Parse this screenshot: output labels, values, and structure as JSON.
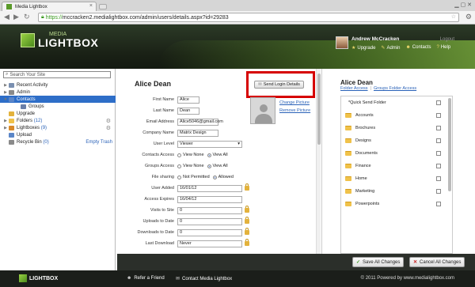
{
  "browser": {
    "tab_title": "Media Lightbox",
    "tab_close": "×",
    "url_scheme": "https://",
    "url_rest": "mccracken2.medialightbox.com/admin/users/details.aspx?id=29283"
  },
  "header": {
    "logo_small": "MEDIA",
    "logo_large": "LIGHTBOX",
    "user_name": "Andrew McCracken",
    "logout": "Logout",
    "menu": [
      {
        "icon": "star-icon",
        "label": "Upgrade"
      },
      {
        "icon": "wrench-icon",
        "label": "Admin"
      },
      {
        "icon": "contacts-icon",
        "label": "Contacts"
      },
      {
        "icon": "help-icon",
        "label": "Help"
      }
    ]
  },
  "sidebar": {
    "search_placeholder": "Search Your Site",
    "items": [
      {
        "label": "Recent Activity",
        "arrow": "▶",
        "color": "#7a8fb0"
      },
      {
        "label": "Admin",
        "arrow": "▶",
        "color": "#8a8a8a"
      },
      {
        "label": "Contacts",
        "arrow": "▼",
        "color": "#5b86c8",
        "selected": true
      },
      {
        "label": "Groups",
        "arrow": "",
        "color": "#6a7fa8",
        "indent": 1
      },
      {
        "label": "Upgrade",
        "arrow": "",
        "color": "#e3b23c"
      },
      {
        "label": "Folders",
        "count": "(12)",
        "arrow": "▶",
        "color": "#f0c24a",
        "gear": true
      },
      {
        "label": "Lightboxes",
        "count": "(9)",
        "arrow": "▶",
        "color": "#d98a2a",
        "gear": true
      },
      {
        "label": "Upload",
        "arrow": "",
        "color": "#5b86c8"
      },
      {
        "label": "Recycle Bin",
        "count": "(0)",
        "arrow": "",
        "color": "#8a8a8a",
        "link": "Empty Trash"
      }
    ]
  },
  "contact": {
    "title": "Alice Dean",
    "send_login": "Send Login Details",
    "change_picture": "Change Picture",
    "remove_picture": "Remove Picture",
    "fields": [
      {
        "label": "First Name",
        "type": "input",
        "value": "Alice",
        "width": 28
      },
      {
        "label": "Last Name",
        "type": "input",
        "value": "Dean",
        "width": 28
      },
      {
        "label": "Email Address",
        "type": "input",
        "value": "Alice5046@gmail.com",
        "width": 52
      },
      {
        "label": "Company Name",
        "type": "input",
        "value": "Matrix Design",
        "width": 52
      },
      {
        "label": "User Level",
        "type": "select",
        "value": "Viewer"
      },
      {
        "label": "Contacts Access",
        "type": "radio",
        "options": [
          "View None",
          "View All"
        ],
        "selected": 1
      },
      {
        "label": "Groups Access",
        "type": "radio",
        "options": [
          "View None",
          "View All"
        ],
        "selected": 1
      },
      {
        "label": "File sharing",
        "type": "radio",
        "options": [
          "Not Permitted",
          "Allowed"
        ],
        "selected": 1
      },
      {
        "label": "User Added",
        "type": "input",
        "value": "16/01/12",
        "width": 82,
        "lock": true
      },
      {
        "label": "Access Expires",
        "type": "input",
        "value": "16/04/12",
        "width": 82
      },
      {
        "label": "Visits to Site",
        "type": "input",
        "value": "0",
        "width": 82,
        "lock": true
      },
      {
        "label": "Uploads to Date",
        "type": "input",
        "value": "0",
        "width": 82,
        "lock": true
      },
      {
        "label": "Downloads to Date",
        "type": "input",
        "value": "0",
        "width": 82,
        "lock": true
      },
      {
        "label": "Last Download",
        "type": "input",
        "value": "Never",
        "width": 82,
        "lock": true
      }
    ]
  },
  "access": {
    "title": "Alice Dean",
    "tab_folder": "Folder Access",
    "tab_sep": "|",
    "tab_groups": "Groups Folder Access",
    "folders": [
      {
        "label": "*Quick Send Folder",
        "first": true
      },
      {
        "label": "Accounts"
      },
      {
        "label": "Brochures"
      },
      {
        "label": "Designs"
      },
      {
        "label": "Documents"
      },
      {
        "label": "Finance"
      },
      {
        "label": "Home"
      },
      {
        "label": "Marketing"
      },
      {
        "label": "Powerpoints"
      }
    ]
  },
  "actions": {
    "save_icon": "✓",
    "save": "Save All Changes",
    "cancel_icon": "✕",
    "cancel": "Cancel All Changes"
  },
  "footer": {
    "logo": "LIGHTBOX",
    "refer": "Refer a Friend",
    "contact": "Contact Media Lightbox",
    "copyright": "© 2011 Powered by www.medialightbox.com"
  }
}
